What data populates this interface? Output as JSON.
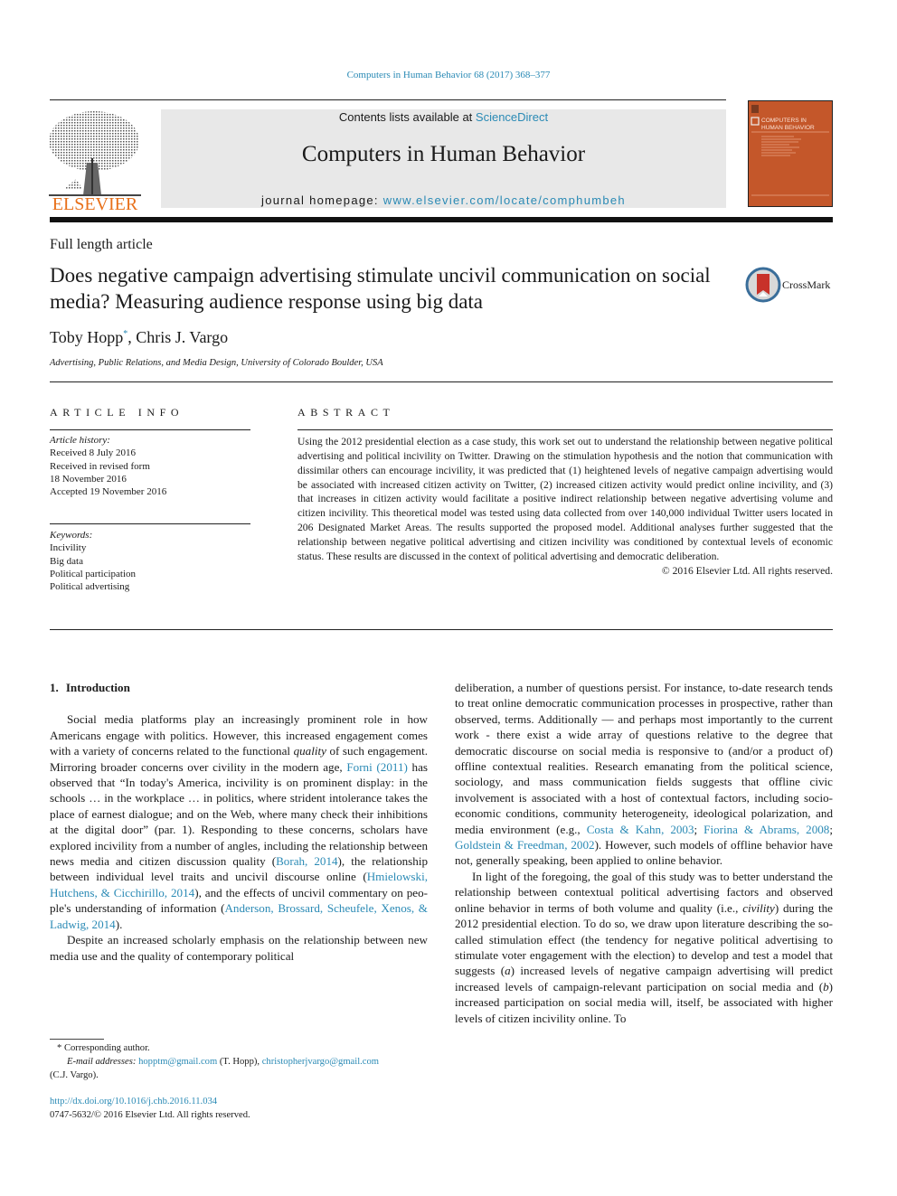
{
  "header": {
    "citation": "Computers in Human Behavior 68 (2017) 368–377",
    "publisher_logo_text": "ELSEVIER",
    "contents_prefix": "Contents lists available at ",
    "contents_link": "ScienceDirect",
    "journal_title": "Computers in Human Behavior",
    "homepage_prefix": "journal homepage: ",
    "homepage_link": "www.elsevier.com/locate/comphumbeh",
    "cover_title_line1": "COMPUTERS IN",
    "cover_title_line2": "HUMAN BEHAVIOR",
    "cover_color": "#c4572a",
    "link_color": "#2a8ab5",
    "logo_color": "#e8701a"
  },
  "article": {
    "type": "Full length article",
    "title": "Does negative campaign advertising stimulate uncivil communication on social media? Measuring audience response using big data",
    "crossmark_label": "CrossMark",
    "authors": [
      {
        "name": "Toby Hopp",
        "marker": "*"
      },
      {
        "name": "Chris J. Vargo",
        "marker": ""
      }
    ],
    "author_separator": ", ",
    "affiliation": "Advertising, Public Relations, and Media Design, University of Colorado Boulder, USA"
  },
  "article_info": {
    "heading": "ARTICLE INFO",
    "history_label": "Article history:",
    "history": [
      "Received 8 July 2016",
      "Received in revised form",
      "18 November 2016",
      "Accepted 19 November 2016"
    ],
    "keywords_label": "Keywords:",
    "keywords": [
      "Incivility",
      "Big data",
      "Political participation",
      "Political advertising"
    ]
  },
  "abstract": {
    "heading": "ABSTRACT",
    "text": "Using the 2012 presidential election as a case study, this work set out to understand the relationship between negative political advertising and political incivility on Twitter. Drawing on the stimulation hypothesis and the notion that communication with dissimilar others can encourage incivility, it was predicted that (1) heightened levels of negative campaign advertising would be associated with increased citizen activity on Twitter, (2) increased citizen activity would predict online incivility, and (3) that increases in citizen activity would facilitate a positive indirect relationship between negative advertising volume and citizen incivility. This theoretical model was tested using data collected from over 140,000 individual Twitter users located in 206 Designated Market Areas. The results supported the proposed model. Additional analyses further suggested that the relationship between negative political advertising and citizen incivility was conditioned by contextual levels of economic status. These results are discussed in the context of political advertising and democratic deliberation.",
    "copyright": "© 2016 Elsevier Ltd. All rights reserved."
  },
  "body": {
    "section_number": "1.",
    "section_title": "Introduction",
    "p1": {
      "a": "Social media platforms play an increasingly prominent role in how Americans engage with politics. However, this increased engagement comes with a variety of concerns related to the func­tional ",
      "a_em": "quality",
      "b": " of such engagement. Mirroring broader concerns over civility in the modern age, ",
      "cite1": "Forni (2011)",
      "c": " has observed that “In to­day's America, incivility is on prominent display: in the schools … in the workplace … in politics, where strident intolerance takes the place of earnest dialogue; and on the Web, where many check their inhibitions at the digital door” (par. 1). Responding to these con­cerns, scholars have explored incivility from a number of angles, including the relationship between news media and citizen dis­cussion quality (",
      "cite2": "Borah, 2014",
      "d": "), the relationship between individual level traits and uncivil discourse online (",
      "cite3": "Hmielowski, Hutchens, & Cicchirillo, 2014",
      "e": "), and the effects of uncivil commentary on peo­ple's understanding of information (",
      "cite4": "Anderson, Brossard, Scheufele, Xenos, & Ladwig, 2014",
      "f": ")."
    },
    "p2": "Despite an increased scholarly emphasis on the relationship between new media use and the quality of contemporary political",
    "p2_cont": {
      "a": "deliberation, a number of questions persist. For instance, to-date research tends to treat online democratic communication pro­cesses in prospective, rather than observed, terms. Additionally — and perhaps most importantly to the current work - there exist a wide array of questions relative to the degree that democratic discourse on social media is responsive to (and/or a product of) offline contextual realities. Research emanating from the political science, sociology, and mass communication fields suggests that offline civic involvement is associated with a host of contextual factors, including socio-economic conditions, community hetero­geneity, ideological polarization, and media environment (e.g., ",
      "cite1": "Costa & Kahn, 2003",
      "sep1": "; ",
      "cite2": "Fiorina & Abrams, 2008",
      "sep2": "; ",
      "cite3": "Goldstein & Freedman, 2002",
      "b": "). However, such models of offline behavior have not, generally speaking, been applied to online behavior."
    },
    "p3": {
      "a": "In light of the foregoing, the goal of this study was to better understand the relationship between contextual political adver­tising factors and observed online behavior in terms of both volume and quality (i.e., ",
      "a_em": "civility",
      "b": ") during the 2012 presidential election. To do so, we draw upon literature describing the so-called stimulation effect (the tendency for negative political advertising to stimulate voter engagement with the election) to develop and test a model that suggests (",
      "em_a": "a",
      "c": ") increased levels of negative campaign advertising will predict increased levels of campaign-relevant participation on social media and (",
      "em_b": "b",
      "d": ") increased participation on social media will, itself, be associated with higher levels of citizen incivility online. To"
    }
  },
  "footnotes": {
    "marker": "*",
    "corresponding": " Corresponding author.",
    "email_label": "E-mail addresses: ",
    "email1": "hopptm@gmail.com",
    "email1_owner": " (T. Hopp), ",
    "email2": "christopherjvargo@gmail.com",
    "email2_owner": "(C.J. Vargo).",
    "doi": "http://dx.doi.org/10.1016/j.chb.2016.11.034",
    "issn": "0747-5632/© 2016 Elsevier Ltd. All rights reserved."
  }
}
